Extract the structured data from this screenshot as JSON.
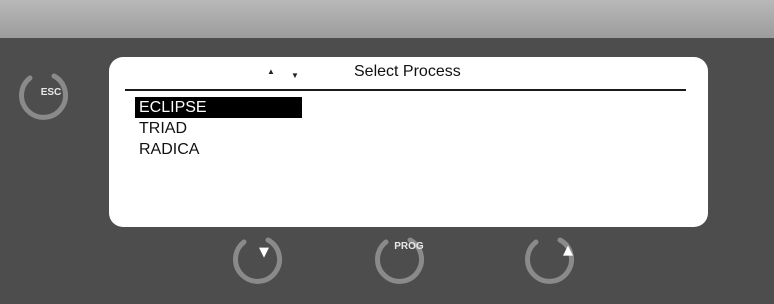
{
  "screen": {
    "title": "Select Process",
    "scroll_up_glyph": "▲",
    "scroll_down_glyph": "▼",
    "processes": [
      "ECLIPSE",
      "TRIAD",
      "RADICA"
    ],
    "selected_index": 0
  },
  "buttons": {
    "esc_label": "ESC",
    "prog_label": "PROG",
    "down_glyph": "▼",
    "up_glyph": "▲"
  },
  "colors": {
    "panel": "#4d4d4d",
    "knob": "#8a8a8a",
    "selection": "#000000"
  }
}
